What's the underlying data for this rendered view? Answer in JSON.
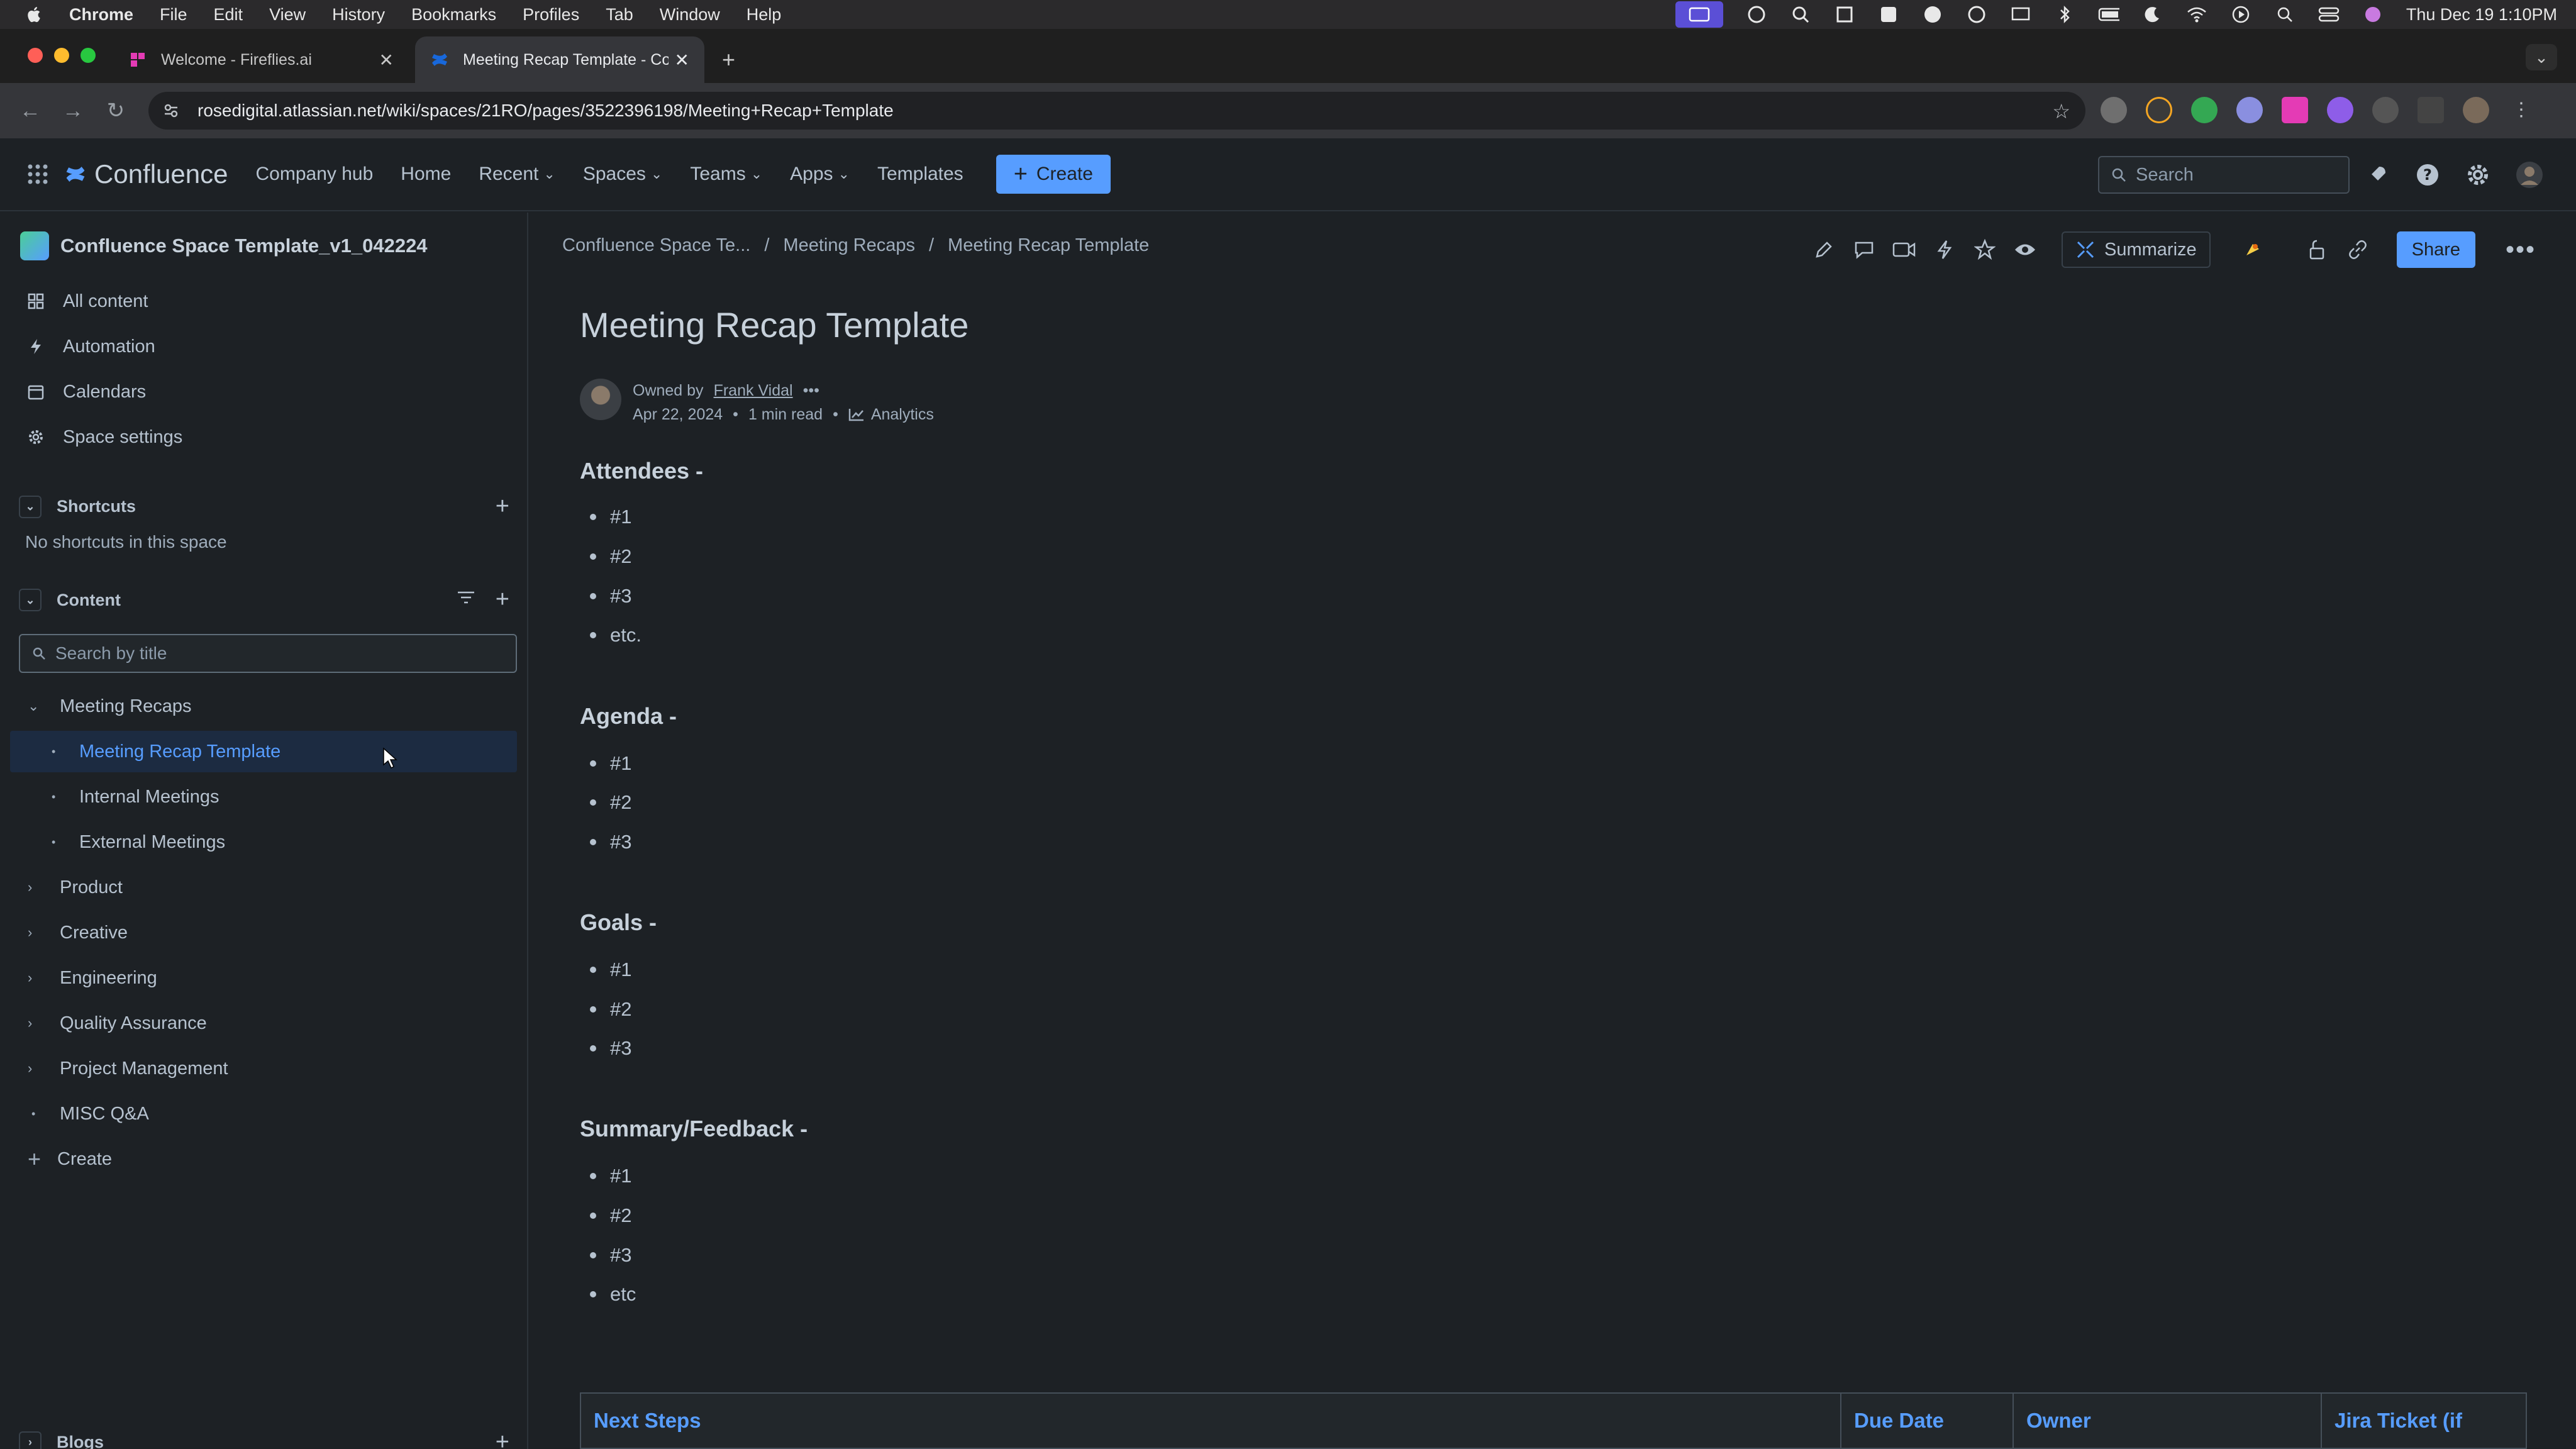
{
  "menubar": {
    "items": [
      "Chrome",
      "File",
      "Edit",
      "View",
      "History",
      "Bookmarks",
      "Profiles",
      "Tab",
      "Window",
      "Help"
    ],
    "clock": "Thu Dec 19  1:10PM"
  },
  "tabs": [
    {
      "title": "Welcome - Fireflies.ai"
    },
    {
      "title": "Meeting Recap Template - Co"
    }
  ],
  "address": {
    "url": "rosedigital.atlassian.net/wiki/spaces/21RO/pages/3522396198/Meeting+Recap+Template"
  },
  "confluence_nav": {
    "logo": "Confluence",
    "links": [
      "Company hub",
      "Home",
      "Recent",
      "Spaces",
      "Teams",
      "Apps",
      "Templates"
    ],
    "create": "Create",
    "search_placeholder": "Search"
  },
  "sidebar": {
    "space_name": "Confluence Space Template_v1_042224",
    "nav": [
      "All content",
      "Automation",
      "Calendars",
      "Space settings"
    ],
    "shortcuts_title": "Shortcuts",
    "no_shortcuts": "No shortcuts in this space",
    "content_title": "Content",
    "search_placeholder": "Search by title",
    "tree": [
      {
        "label": "Meeting Recaps"
      },
      {
        "label": "Meeting Recap Template"
      },
      {
        "label": "Internal Meetings"
      },
      {
        "label": "External Meetings"
      },
      {
        "label": "Product"
      },
      {
        "label": "Creative"
      },
      {
        "label": "Engineering"
      },
      {
        "label": "Quality Assurance"
      },
      {
        "label": "Project Management"
      },
      {
        "label": "MISC Q&A"
      },
      {
        "label": "Create"
      }
    ],
    "blogs_title": "Blogs"
  },
  "page": {
    "breadcrumb": [
      "Confluence Space Te...",
      "/",
      "Meeting Recaps",
      "/",
      "Meeting Recap Template"
    ],
    "summarize": "Summarize",
    "share": "Share",
    "title": "Meeting Recap Template",
    "owned_by_prefix": "Owned by",
    "owner": "Frank Vidal",
    "date": "Apr 22, 2024",
    "read_time": "1 min read",
    "analytics": "Analytics",
    "sections": [
      {
        "heading": "Attendees -",
        "items": [
          "#1",
          "#2",
          "#3",
          "etc."
        ]
      },
      {
        "heading": "Agenda -",
        "items": [
          "#1",
          "#2",
          "#3"
        ]
      },
      {
        "heading": "Goals -",
        "items": [
          "#1",
          "#2",
          "#3"
        ]
      },
      {
        "heading": "Summary/Feedback -",
        "items": [
          "#1",
          "#2",
          "#3",
          "etc"
        ]
      }
    ],
    "table_headers": [
      "Next Steps",
      "Due Date",
      "Owner",
      "Jira Ticket (if"
    ]
  }
}
